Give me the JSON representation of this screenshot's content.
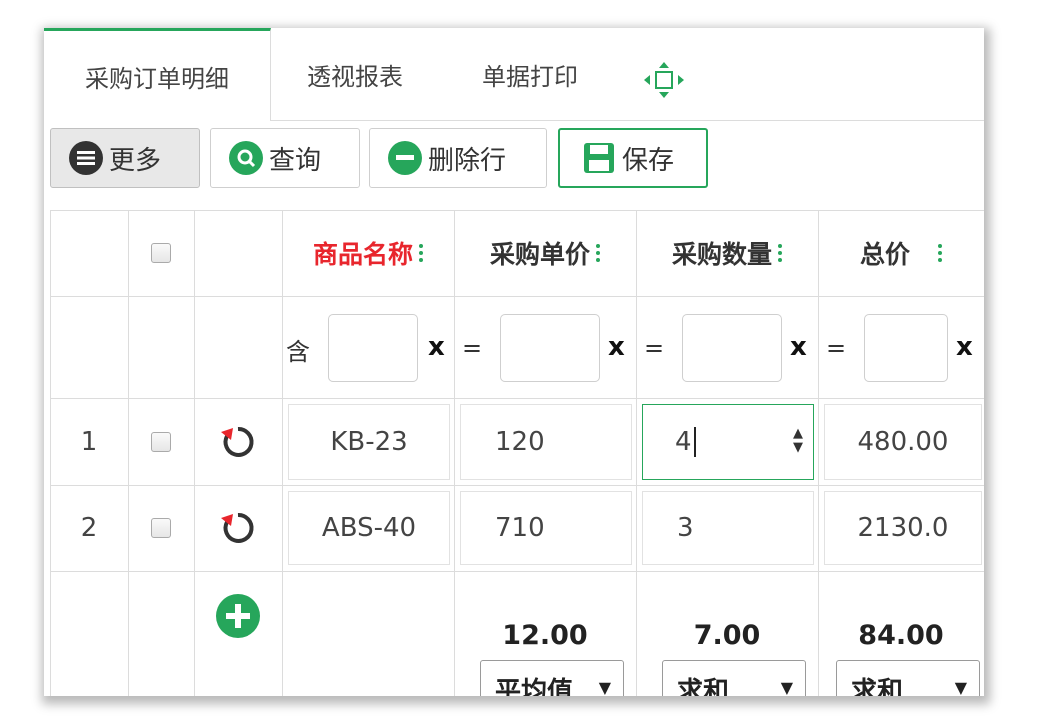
{
  "tabs": [
    {
      "label": "采购订单明细",
      "active": true
    },
    {
      "label": "透视报表",
      "active": false
    },
    {
      "label": "单据打印",
      "active": false
    }
  ],
  "move_icon": "move-arrows-icon",
  "toolbar": {
    "more": "更多",
    "query": "查询",
    "delete_row": "删除行",
    "save": "保存"
  },
  "colors": {
    "accent": "#26a65b",
    "required": "#e8262d",
    "reset": "#e8262d"
  },
  "columns": {
    "name": "商品名称",
    "price": "采购单价",
    "qty": "采购数量",
    "total": "总价"
  },
  "filters": {
    "name_op": "含",
    "price_op": "=",
    "qty_op": "=",
    "total_op": "=",
    "clear": "x"
  },
  "rows": [
    {
      "no": "1",
      "name": "KB-23",
      "price": "120",
      "qty": "4",
      "total": "480.00"
    },
    {
      "no": "2",
      "name": "ABS-40",
      "price": "710",
      "qty": "3",
      "total": "2130.0"
    }
  ],
  "summary": {
    "price": {
      "value": "12.00",
      "agg": "平均值"
    },
    "qty": {
      "value": "7.00",
      "agg": "求和"
    },
    "total": {
      "value": "84.00",
      "agg": "求和"
    }
  }
}
